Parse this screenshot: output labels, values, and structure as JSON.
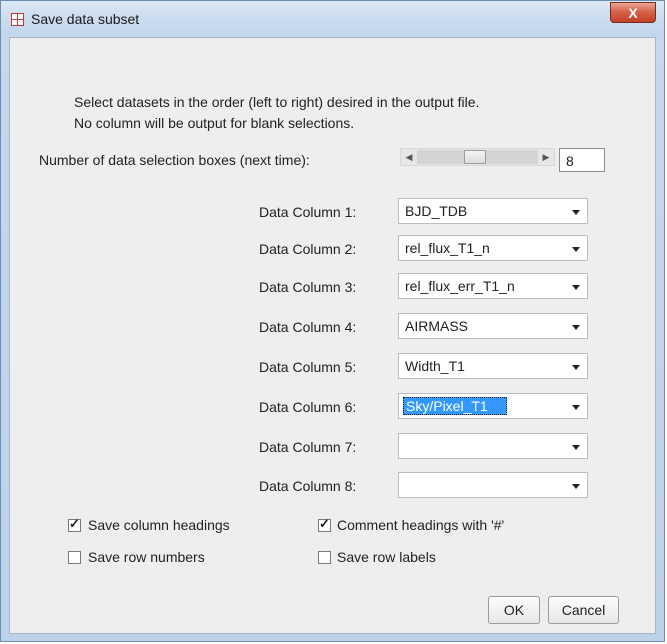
{
  "window": {
    "title": "Save data subset",
    "close_label": "X"
  },
  "instructions": [
    "Select datasets in the order (left to right) desired in the output file.",
    "No column will be output for blank selections."
  ],
  "boxes": {
    "label": "Number of data selection boxes (next time):",
    "value": "8"
  },
  "columns": [
    {
      "label": "Data Column 1:",
      "value": "BJD_TDB"
    },
    {
      "label": "Data Column 2:",
      "value": "rel_flux_T1_n"
    },
    {
      "label": "Data Column 3:",
      "value": "rel_flux_err_T1_n"
    },
    {
      "label": "Data Column 4:",
      "value": "AIRMASS"
    },
    {
      "label": "Data Column 5:",
      "value": "Width_T1"
    },
    {
      "label": "Data Column 6:",
      "value": "Sky/Pixel_T1"
    },
    {
      "label": "Data Column 7:",
      "value": ""
    },
    {
      "label": "Data Column 8:",
      "value": ""
    }
  ],
  "options": {
    "save_headings": {
      "label": "Save column headings",
      "checked": true
    },
    "comment_headings": {
      "label": "Comment headings with '#'",
      "checked": true
    },
    "save_row_numbers": {
      "label": "Save row numbers",
      "checked": false
    },
    "save_row_labels": {
      "label": "Save row labels",
      "checked": false
    }
  },
  "buttons": {
    "ok": "OK",
    "cancel": "Cancel"
  }
}
